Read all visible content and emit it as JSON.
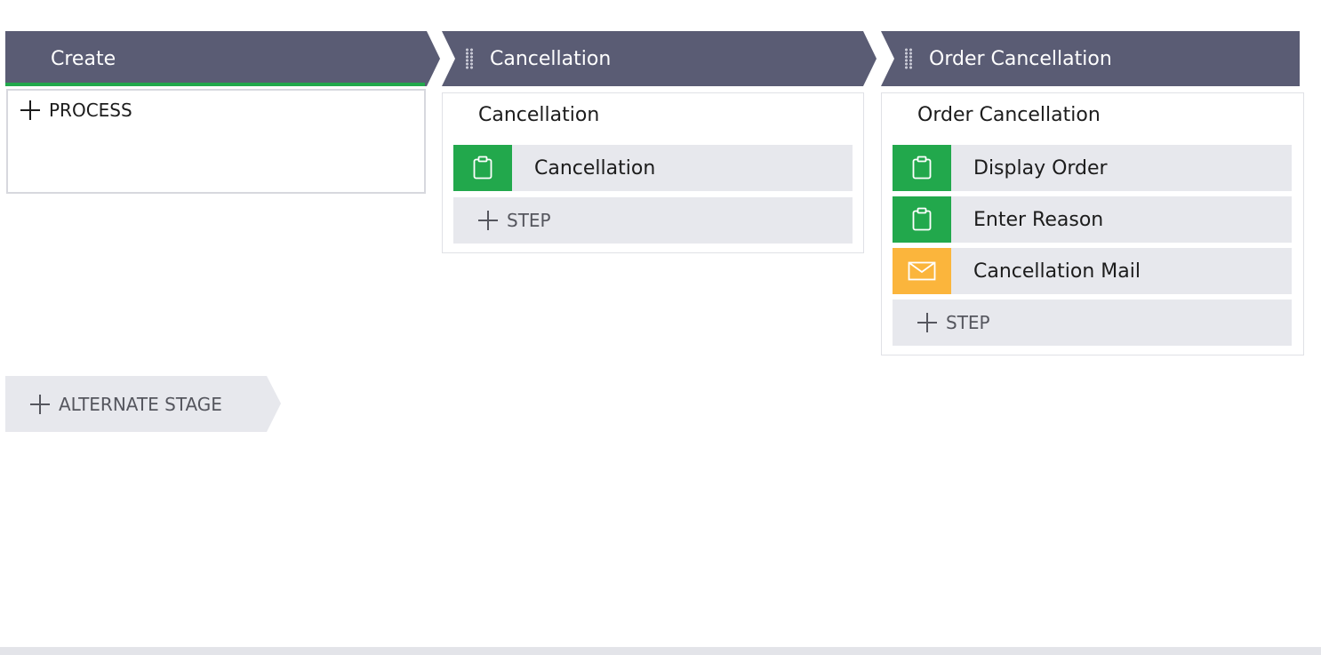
{
  "stages": [
    {
      "label": "Create"
    },
    {
      "label": "Cancellation"
    },
    {
      "label": "Order Cancellation"
    }
  ],
  "create_box": {
    "add_process_label": "PROCESS"
  },
  "cancellation_process": {
    "title": "Cancellation",
    "steps": [
      {
        "label": "Cancellation",
        "icon": "clipboard-icon",
        "color": "#22a84c"
      }
    ],
    "add_step_label": "STEP"
  },
  "order_cancellation_process": {
    "title": "Order Cancellation",
    "steps": [
      {
        "label": "Display Order",
        "icon": "clipboard-icon",
        "color": "#22a84c"
      },
      {
        "label": "Enter Reason",
        "icon": "clipboard-icon",
        "color": "#22a84c"
      },
      {
        "label": "Cancellation Mail",
        "icon": "envelope-icon",
        "color": "#fbb53c"
      }
    ],
    "add_step_label": "STEP"
  },
  "alternate_stage_label": "ALTERNATE STAGE",
  "colors": {
    "stage_header": "#5a5c74",
    "accent_green": "#22a84c",
    "accent_orange": "#fbb53c",
    "step_background": "#e7e8ed"
  }
}
